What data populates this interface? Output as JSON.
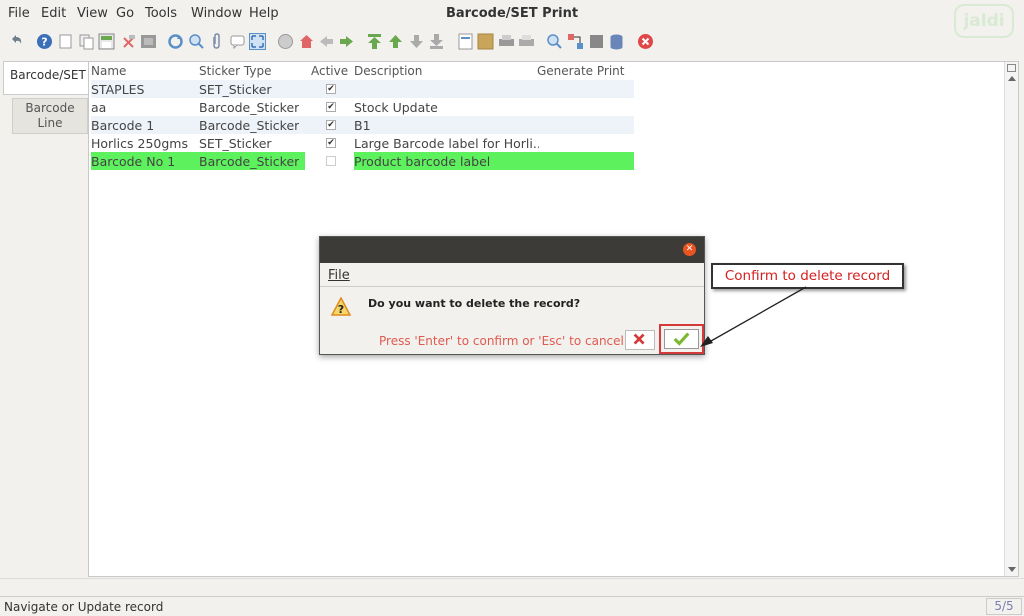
{
  "window": {
    "title": "Barcode/SET Print",
    "logo_text": "jaldi"
  },
  "menu": [
    {
      "label": "File"
    },
    {
      "label": "Edit"
    },
    {
      "label": "View"
    },
    {
      "label": "Go"
    },
    {
      "label": "Tools"
    },
    {
      "label": "Window"
    },
    {
      "label": "Help"
    }
  ],
  "tabs": {
    "header": "Barcode/SET",
    "line": "Barcode Line"
  },
  "grid": {
    "headers": {
      "name": "Name",
      "sticker": "Sticker Type",
      "active": "Active",
      "desc": "Description",
      "gen": "Generate Print"
    },
    "rows": [
      {
        "name": "STAPLES",
        "sticker": "SET_Sticker",
        "active": true,
        "desc": ""
      },
      {
        "name": "aa",
        "sticker": "Barcode_Sticker",
        "active": true,
        "desc": "Stock Update"
      },
      {
        "name": "Barcode 1",
        "sticker": "Barcode_Sticker",
        "active": true,
        "desc": "B1"
      },
      {
        "name": "Horlics 250gms",
        "sticker": "SET_Sticker",
        "active": true,
        "desc": "Large Barcode label for Horli..."
      },
      {
        "name": "Barcode No 1",
        "sticker": "Barcode_Sticker",
        "active": false,
        "desc": "Product barcode label"
      }
    ],
    "selected_row_color": "#5df25d"
  },
  "dialog": {
    "menu_label": "File",
    "message": "Do you want to delete the record?",
    "hint": "Press 'Enter' to confirm or 'Esc' to cancel",
    "icons": {
      "warning": "warning-icon",
      "cancel": "cancel-x-icon",
      "ok": "checkmark-icon"
    }
  },
  "callout": {
    "text": "Confirm to delete record"
  },
  "status": {
    "text": "Navigate or Update record",
    "count": "5/5"
  }
}
